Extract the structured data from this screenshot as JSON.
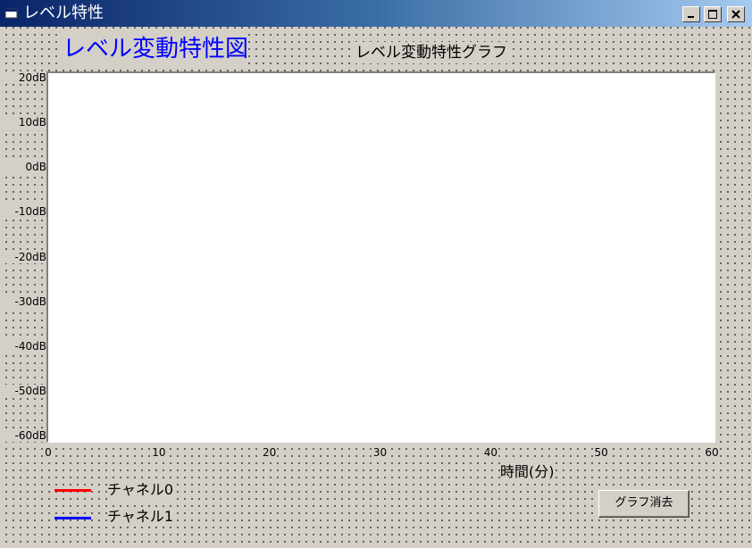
{
  "window": {
    "title": "レベル特性"
  },
  "heading": "レベル変動特性図",
  "graph": {
    "title": "レベル変動特性グラフ",
    "y_ticks": [
      "20dB",
      "10dB",
      "0dB",
      "-10dB",
      "-20dB",
      "-30dB",
      "-40dB",
      "-50dB",
      "-60dB"
    ],
    "x_ticks": [
      "0",
      "10",
      "20",
      "30",
      "40",
      "50",
      "60"
    ],
    "x_label": "時間(分)"
  },
  "legend": [
    {
      "label": "チャネル0",
      "color": "#ff0000"
    },
    {
      "label": "チャネル1",
      "color": "#0000ff"
    }
  ],
  "buttons": {
    "clear_graph": "グラフ消去"
  },
  "colors": {
    "heading": "#0000ff",
    "face": "#d4d0c8",
    "plot_bg": "#ffffff"
  }
}
